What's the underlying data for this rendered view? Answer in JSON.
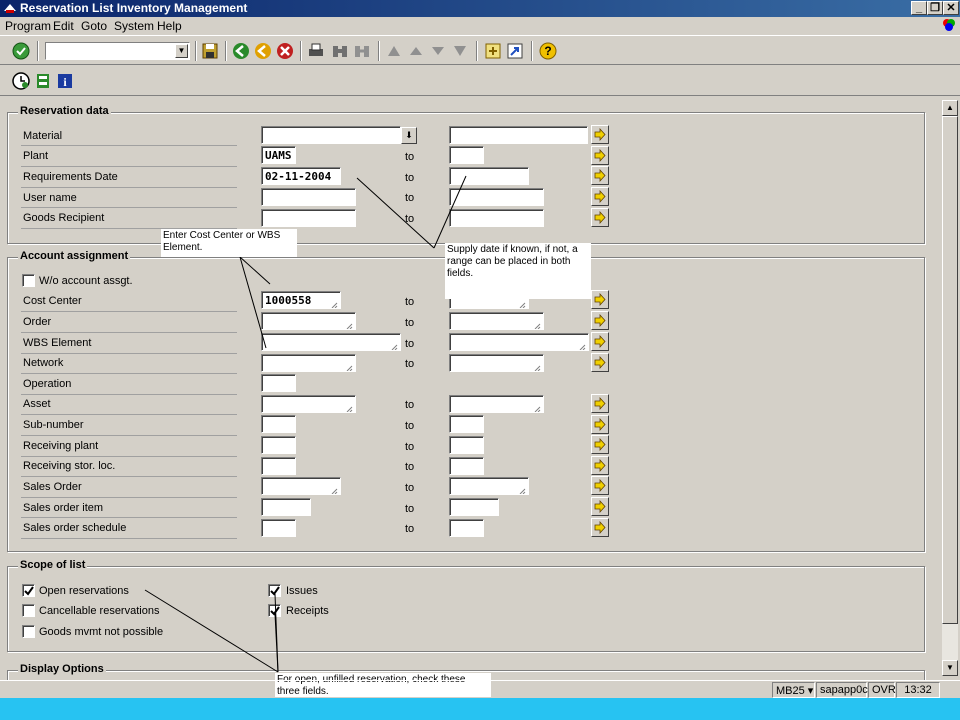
{
  "window": {
    "title": "Reservation List Inventory Management"
  },
  "menu": [
    "Program",
    "Edit",
    "Goto",
    "System",
    "Help"
  ],
  "sections": {
    "reservation": "Reservation data",
    "account": "Account assignment",
    "scope": "Scope of list",
    "display": "Display Options"
  },
  "to_label": "to",
  "reservation_fields": {
    "material": {
      "label": "Material",
      "value": ""
    },
    "plant": {
      "label": "Plant",
      "value": "UAMS"
    },
    "req_date": {
      "label": "Requirements Date",
      "value": "02-11-2004"
    },
    "user_name": {
      "label": "User name",
      "value": ""
    },
    "goods_recipient": {
      "label": "Goods Recipient",
      "value": ""
    }
  },
  "account_fields": {
    "wo_assgt": "W/o account assgt.",
    "cost_center": {
      "label": "Cost Center",
      "value": "1000558"
    },
    "order": "Order",
    "wbs": "WBS Element",
    "network": "Network",
    "operation": "Operation",
    "asset": "Asset",
    "sub_number": "Sub-number",
    "recv_plant": "Receiving plant",
    "recv_sloc": "Receiving stor. loc.",
    "sales_order": "Sales Order",
    "sales_item": "Sales order item",
    "sales_sched": "Sales order schedule"
  },
  "scope": {
    "open": {
      "label": "Open reservations",
      "checked": true
    },
    "cancellable": {
      "label": "Cancellable reservations",
      "checked": false
    },
    "goods_mvmt": {
      "label": "Goods mvmt not possible",
      "checked": false
    },
    "issues": {
      "label": "Issues",
      "checked": true
    },
    "receipts": {
      "label": "Receipts",
      "checked": true
    }
  },
  "callouts": {
    "wbs": "Enter Cost Center or WBS Element.",
    "supply": "Supply date if known, if not, a range can be placed in both fields.",
    "open": "For open, unfilled reservation, check these three fields."
  },
  "status": {
    "tcode": "MB25",
    "server": "sapapp0c",
    "mode": "OVR",
    "time": "13:32"
  },
  "colors": {
    "title_bar": "#0a246a",
    "bottom_strip": "#27c3f2",
    "background": "#d4d0c8"
  }
}
